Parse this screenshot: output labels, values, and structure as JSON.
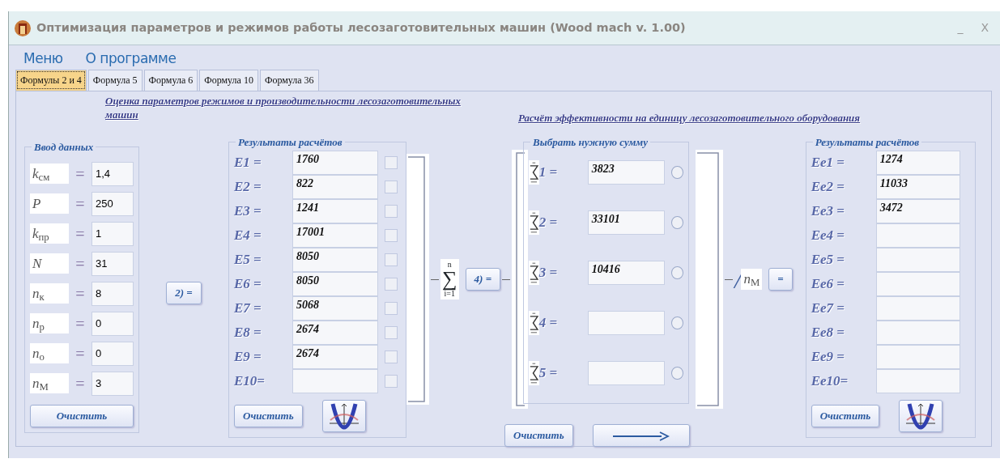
{
  "window": {
    "title": "Оптимизация параметров и режимов работы лесозаготовительных машин (Wood mach v. 1.00)",
    "minimize": "_",
    "close": "X"
  },
  "menu": [
    "Меню",
    "О программе"
  ],
  "tabs": [
    {
      "label": "Формулы 2 и 4",
      "selected": true
    },
    {
      "label": "Формула 5",
      "selected": false
    },
    {
      "label": "Формула 6",
      "selected": false
    },
    {
      "label": "Формула 10",
      "selected": false
    },
    {
      "label": "Формула 36",
      "selected": false
    }
  ],
  "headings": [
    "Оценка параметров режимов и производительности лесозаготовительных машин",
    "Расчёт эффективности на единицу лесозаготовительного оборудования"
  ],
  "input": {
    "title": "Ввод данных",
    "rows": [
      {
        "label": "*k*$_{см}$",
        "eq": "=",
        "value": "1,4"
      },
      {
        "label": "*P*",
        "eq": "=",
        "value": "250"
      },
      {
        "label": "*k*$_{пр}$",
        "eq": "=",
        "value": "1"
      },
      {
        "label": "*N*",
        "eq": "=",
        "value": "31"
      },
      {
        "label": "*n*$_{к}$",
        "eq": "=",
        "value": "8"
      },
      {
        "label": "*n*$_{р}$",
        "eq": "=",
        "value": "0"
      },
      {
        "label": "*n*$_{о}$",
        "eq": "=",
        "value": "0"
      },
      {
        "label": "*n*$_{М}$",
        "eq": "=",
        "value": "3"
      }
    ],
    "clear": "Очистить"
  },
  "step2": "2) =",
  "results": {
    "title": "Результаты расчётов",
    "rows": [
      {
        "label": "E1 =",
        "value": "1760",
        "checked": false
      },
      {
        "label": "E2 =",
        "value": "822",
        "checked": false
      },
      {
        "label": "E3 =",
        "value": "1241",
        "checked": false
      },
      {
        "label": "E4 =",
        "value": "17001",
        "checked": false
      },
      {
        "label": "E5 =",
        "value": "8050",
        "checked": false
      },
      {
        "label": "E6 =",
        "value": "8050",
        "checked": false
      },
      {
        "label": "E7 =",
        "value": "5068",
        "checked": false
      },
      {
        "label": "E8 =",
        "value": "2674",
        "checked": false
      },
      {
        "label": "E9 =",
        "value": "2674",
        "checked": false
      },
      {
        "label": "E10=",
        "value": "",
        "checked": false
      }
    ],
    "clear": "Очистить"
  },
  "sum_operator": {
    "symbol": "∑",
    "upper": "n",
    "lower": "i=1"
  },
  "step4": "4) =",
  "sums": {
    "title": "Выбрать нужную сумму",
    "rows": [
      {
        "label": "1 =",
        "value": "3823",
        "selected": false
      },
      {
        "label": "2 =",
        "value": "33101",
        "selected": false
      },
      {
        "label": "3 =",
        "value": "10416",
        "selected": false
      },
      {
        "label": "4 =",
        "value": "",
        "selected": false
      },
      {
        "label": "5 =",
        "value": "",
        "selected": false
      }
    ],
    "clear": "Очистить"
  },
  "divisor": {
    "slash": "/",
    "symbol": "*n*$_{М}$"
  },
  "equals_button": "=",
  "results2": {
    "title": "Результаты расчётов",
    "rows": [
      {
        "label": "Ee1 =",
        "value": "1274"
      },
      {
        "label": "Ee2 =",
        "value": "11033"
      },
      {
        "label": "Ee3 =",
        "value": "3472"
      },
      {
        "label": "Ee4 =",
        "value": ""
      },
      {
        "label": "Ee5 =",
        "value": ""
      },
      {
        "label": "Ee6 =",
        "value": ""
      },
      {
        "label": "Ee7 =",
        "value": ""
      },
      {
        "label": "Ee8 =",
        "value": ""
      },
      {
        "label": "Ee9 =",
        "value": ""
      },
      {
        "label": "Ee10=",
        "value": ""
      }
    ],
    "clear": "Очистить"
  }
}
